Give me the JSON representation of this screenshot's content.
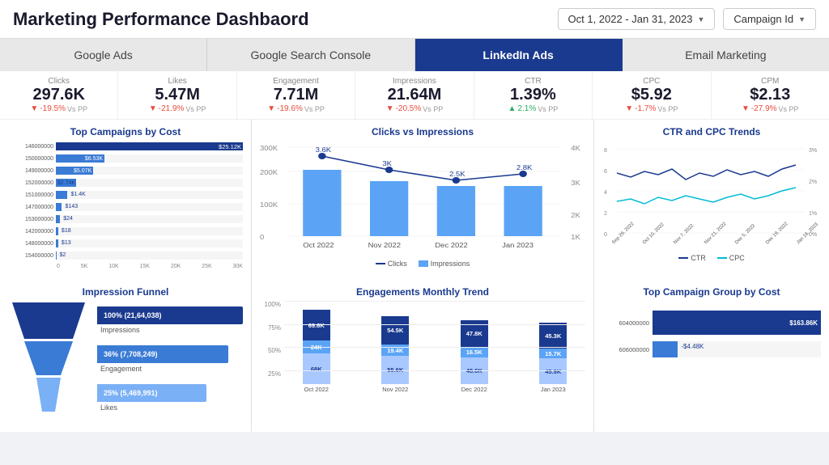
{
  "header": {
    "title": "Marketing Performance Dashbaord",
    "date_range": "Oct 1, 2022 - Jan 31, 2023",
    "campaign_filter": "Campaign Id"
  },
  "tabs": [
    {
      "label": "Google Ads",
      "active": false
    },
    {
      "label": "Google Search Console",
      "active": false
    },
    {
      "label": "LinkedIn Ads",
      "active": true
    },
    {
      "label": "Email Marketing",
      "active": false
    }
  ],
  "metrics": [
    {
      "label": "Clicks",
      "value": "297.6K",
      "change": "-19.5%",
      "direction": "neg",
      "vs": "Vs PP"
    },
    {
      "label": "Likes",
      "value": "5.47M",
      "change": "-21.9%",
      "direction": "neg",
      "vs": "Vs PP"
    },
    {
      "label": "Engagement",
      "value": "7.71M",
      "change": "-19.6%",
      "direction": "neg",
      "vs": "Vs PP"
    },
    {
      "label": "Impressions",
      "value": "21.64M",
      "change": "-20.5%",
      "direction": "neg",
      "vs": "Vs PP"
    },
    {
      "label": "CTR",
      "value": "1.39%",
      "change": "2.1%",
      "direction": "pos",
      "vs": "Vs PP"
    },
    {
      "label": "CPC",
      "value": "$5.92",
      "change": "-1.7%",
      "direction": "neg",
      "vs": "Vs PP"
    },
    {
      "label": "CPM",
      "value": "$2.13",
      "change": "-27.9%",
      "direction": "neg",
      "vs": "Vs PP"
    }
  ],
  "top_campaigns": {
    "title": "Top Campaigns by Cost",
    "bars": [
      {
        "label": "146000000",
        "value": 25.12,
        "pct": 100,
        "display": "$25.12K",
        "highlight": true
      },
      {
        "label": "150000000",
        "value": 6.53,
        "pct": 26,
        "display": "$6.53K",
        "highlight": true
      },
      {
        "label": "149000000",
        "value": 5.07,
        "pct": 20,
        "display": "$5.07K",
        "highlight": true
      },
      {
        "label": "152000000",
        "value": 2.74,
        "pct": 11,
        "display": "$2.74K"
      },
      {
        "label": "151000000",
        "value": 1.4,
        "pct": 6,
        "display": "$1.4K"
      },
      {
        "label": "147000000",
        "value": 0.143,
        "pct": 3,
        "display": "$143"
      },
      {
        "label": "153000000",
        "value": 0.024,
        "pct": 2,
        "display": "$24"
      },
      {
        "label": "142000000",
        "value": 0.018,
        "pct": 1.5,
        "display": "$18"
      },
      {
        "label": "148000000",
        "value": 0.013,
        "pct": 1.2,
        "display": "$13"
      },
      {
        "label": "154000000",
        "value": 0.002,
        "pct": 0.8,
        "display": "$2"
      }
    ],
    "x_labels": [
      "0",
      "5K",
      "10K",
      "15K",
      "20K",
      "25K",
      "30K"
    ]
  },
  "clicks_impressions": {
    "title": "Clicks vs Impressions",
    "months": [
      "Oct 2022",
      "Nov 2022",
      "Dec 2022",
      "Jan 2023"
    ],
    "impressions": [
      260000,
      215000,
      195000,
      195000
    ],
    "clicks": [
      3600,
      3000,
      2500,
      2800
    ],
    "click_labels": [
      "3.6K",
      "3K",
      "2.5K",
      "2.8K"
    ],
    "legend": [
      "Clicks",
      "Impressions"
    ]
  },
  "ctr_cpc": {
    "title": "CTR and CPC Trends",
    "legend": [
      "CTR",
      "CPC"
    ]
  },
  "impression_funnel": {
    "title": "Impression Funnel",
    "levels": [
      {
        "pct": "100%",
        "value": "(21,64,038)",
        "label": "Impressions"
      },
      {
        "pct": "36%",
        "value": "(7,708,249)",
        "label": "Engagement"
      },
      {
        "pct": "25%",
        "value": "(5,469,991)",
        "label": "Likes"
      }
    ]
  },
  "engagements_trend": {
    "title": "Engagements Monthly Trend",
    "months": [
      "Oct 2022",
      "Nov 2022",
      "Dec 2022",
      "Jan 2023"
    ],
    "y_labels": [
      "100%",
      "75%",
      "50%",
      "25%"
    ],
    "bars": [
      {
        "month": "Oct 2022",
        "s1": "69.6K",
        "s2": "24K",
        "s3": "68K",
        "h1": 38,
        "h2": 16,
        "h3": 38
      },
      {
        "month": "Nov 2022",
        "s1": "54.5K",
        "s2": "19.4K",
        "s3": "55.6K",
        "h1": 35,
        "h2": 14,
        "h3": 35
      },
      {
        "month": "Dec 2022",
        "s1": "47.8K",
        "s2": "16.5K",
        "s3": "48.6K",
        "h1": 33,
        "h2": 13,
        "h3": 33
      },
      {
        "month": "Jan 2023",
        "s1": "45.3K",
        "s2": "15.7K",
        "s3": "45.9K",
        "h1": 32,
        "h2": 12,
        "h3": 32
      }
    ]
  },
  "top_campaign_group": {
    "title": "Top Campaign Group by Cost",
    "bars": [
      {
        "label": "604000000",
        "value": 163.86,
        "pct": 100,
        "display": "$163.86K",
        "highlight": true
      },
      {
        "label": "606000000",
        "value": -4.48,
        "pct": 15,
        "display": "-$4.48K",
        "highlight": false
      }
    ]
  }
}
